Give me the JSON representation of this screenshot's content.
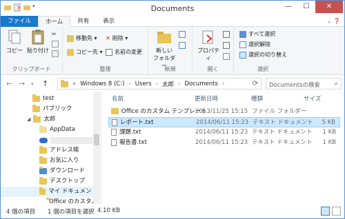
{
  "window": {
    "title": "Documents",
    "colors": {
      "file_tab": "#1979ca",
      "close": "#c75050",
      "selection": "#cce8ff"
    }
  },
  "tabs": [
    {
      "label": "ファイル"
    },
    {
      "label": "ホーム"
    },
    {
      "label": "共有"
    },
    {
      "label": "表示"
    }
  ],
  "ribbon": {
    "clipboard": {
      "copy": "コピー",
      "paste": "貼り付け",
      "label": "クリップボード"
    },
    "organize": {
      "move_to": "移動先 ▾",
      "copy_to": "コピー先 ▾",
      "delete": "削除 ▾",
      "rename": "名前の変更",
      "label": "整理"
    },
    "new": {
      "new_folder_line1": "新しい",
      "new_folder_line2": "フォルダー",
      "label": "新規"
    },
    "open": {
      "properties": "プロパティ",
      "label": "開く"
    },
    "select": {
      "select_all": "すべて選択",
      "select_none": "選択解除",
      "invert": "選択の切り替え",
      "label": "選択"
    }
  },
  "address": {
    "segments": [
      "Windows 8 (C:)",
      "Users",
      "太郎",
      "Documents"
    ],
    "search_placeholder": "Documentsの検索"
  },
  "nav": {
    "items": [
      {
        "label": "test",
        "icon": "folder"
      },
      {
        "label": "パブリック",
        "icon": "folder"
      },
      {
        "label": "太郎",
        "icon": "folder"
      },
      {
        "label": "AppData",
        "icon": "folder"
      },
      {
        "label": "",
        "icon": "cloud"
      },
      {
        "label": "アドレス帳",
        "icon": "folder"
      },
      {
        "label": "お気に入り",
        "icon": "folder"
      },
      {
        "label": "ダウンロード",
        "icon": "download-folder"
      },
      {
        "label": "デスクトップ",
        "icon": "folder"
      },
      {
        "label": "マイ ドキュメント",
        "icon": "folder"
      },
      {
        "label": "Office のカスタム",
        "icon": "folder"
      }
    ]
  },
  "columns": {
    "name": "名前",
    "date": "更新日時",
    "type": "種類",
    "size": "サイズ"
  },
  "files": [
    {
      "name": "Office のカスタム テンプレート",
      "date": "2013/11/25 15:15",
      "type": "ファイル フォルダー",
      "size": "",
      "icon": "folder"
    },
    {
      "name": "レポート.txt",
      "date": "2014/06/11 15:23",
      "type": "テキスト ドキュメント",
      "size": "5 KB",
      "icon": "file"
    },
    {
      "name": "課題.txt",
      "date": "2014/06/11 15:23",
      "type": "テキスト ドキュメント",
      "size": "1 KB",
      "icon": "file"
    },
    {
      "name": "報告書.txt",
      "date": "2014/06/11 15:23",
      "type": "テキスト ドキュメント",
      "size": "1 KB",
      "icon": "file"
    }
  ],
  "status": {
    "count": "4 個の項目",
    "selection": "1 個の項目を選択",
    "size": "4.10 KB"
  }
}
